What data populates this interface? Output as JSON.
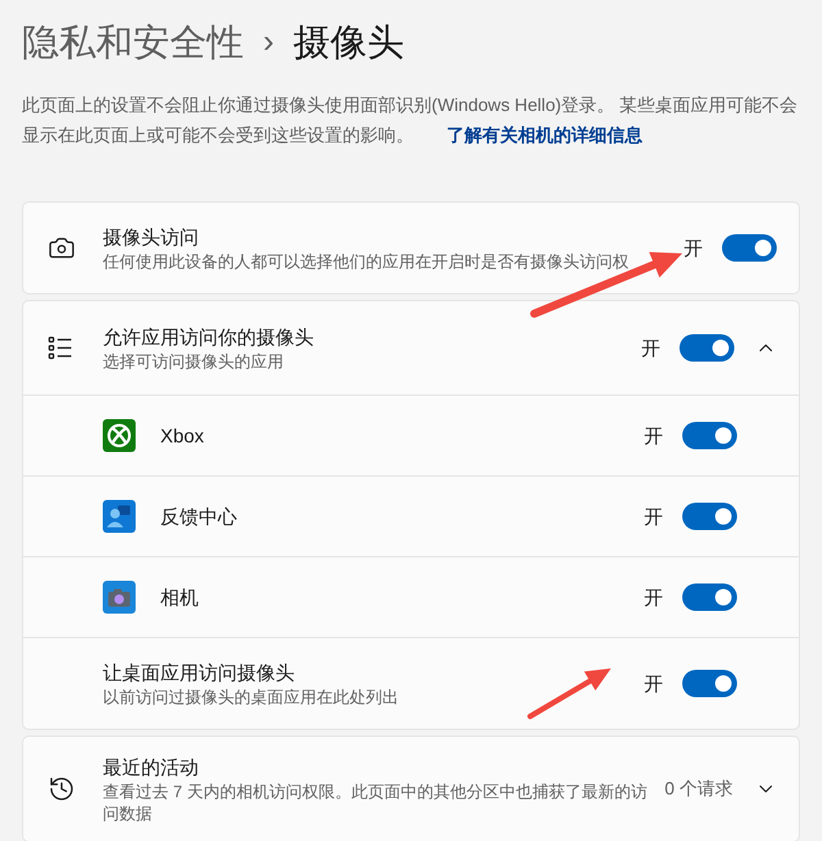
{
  "breadcrumb": {
    "parent": "隐私和安全性",
    "separator": "›",
    "current": "摄像头"
  },
  "description": {
    "text": "此页面上的设置不会阻止你通过摄像头使用面部识别(Windows Hello)登录。 某些桌面应用可能不会显示在此页面上或可能不会受到这些设置的影响。",
    "link": "了解有关相机的详细信息"
  },
  "camera_access": {
    "title": "摄像头访问",
    "subtitle": "任何使用此设备的人都可以选择他们的应用在开启时是否有摄像头访问权",
    "state_label": "开",
    "on": true
  },
  "app_access": {
    "title": "允许应用访问你的摄像头",
    "subtitle": "选择可访问摄像头的应用",
    "state_label": "开",
    "on": true,
    "expanded": true,
    "apps": [
      {
        "name": "Xbox",
        "kind": "xbox",
        "state_label": "开",
        "on": true
      },
      {
        "name": "反馈中心",
        "kind": "feedback",
        "state_label": "开",
        "on": true
      },
      {
        "name": "相机",
        "kind": "camera",
        "state_label": "开",
        "on": true
      }
    ],
    "desktop": {
      "title": "让桌面应用访问摄像头",
      "subtitle": "以前访问过摄像头的桌面应用在此处列出",
      "state_label": "开",
      "on": true
    }
  },
  "recent_activity": {
    "title": "最近的活动",
    "subtitle": "查看过去 7 天内的相机访问权限。此页面中的其他分区中也捕获了最新的访问数据",
    "count": "0 个请求",
    "expanded": false
  }
}
